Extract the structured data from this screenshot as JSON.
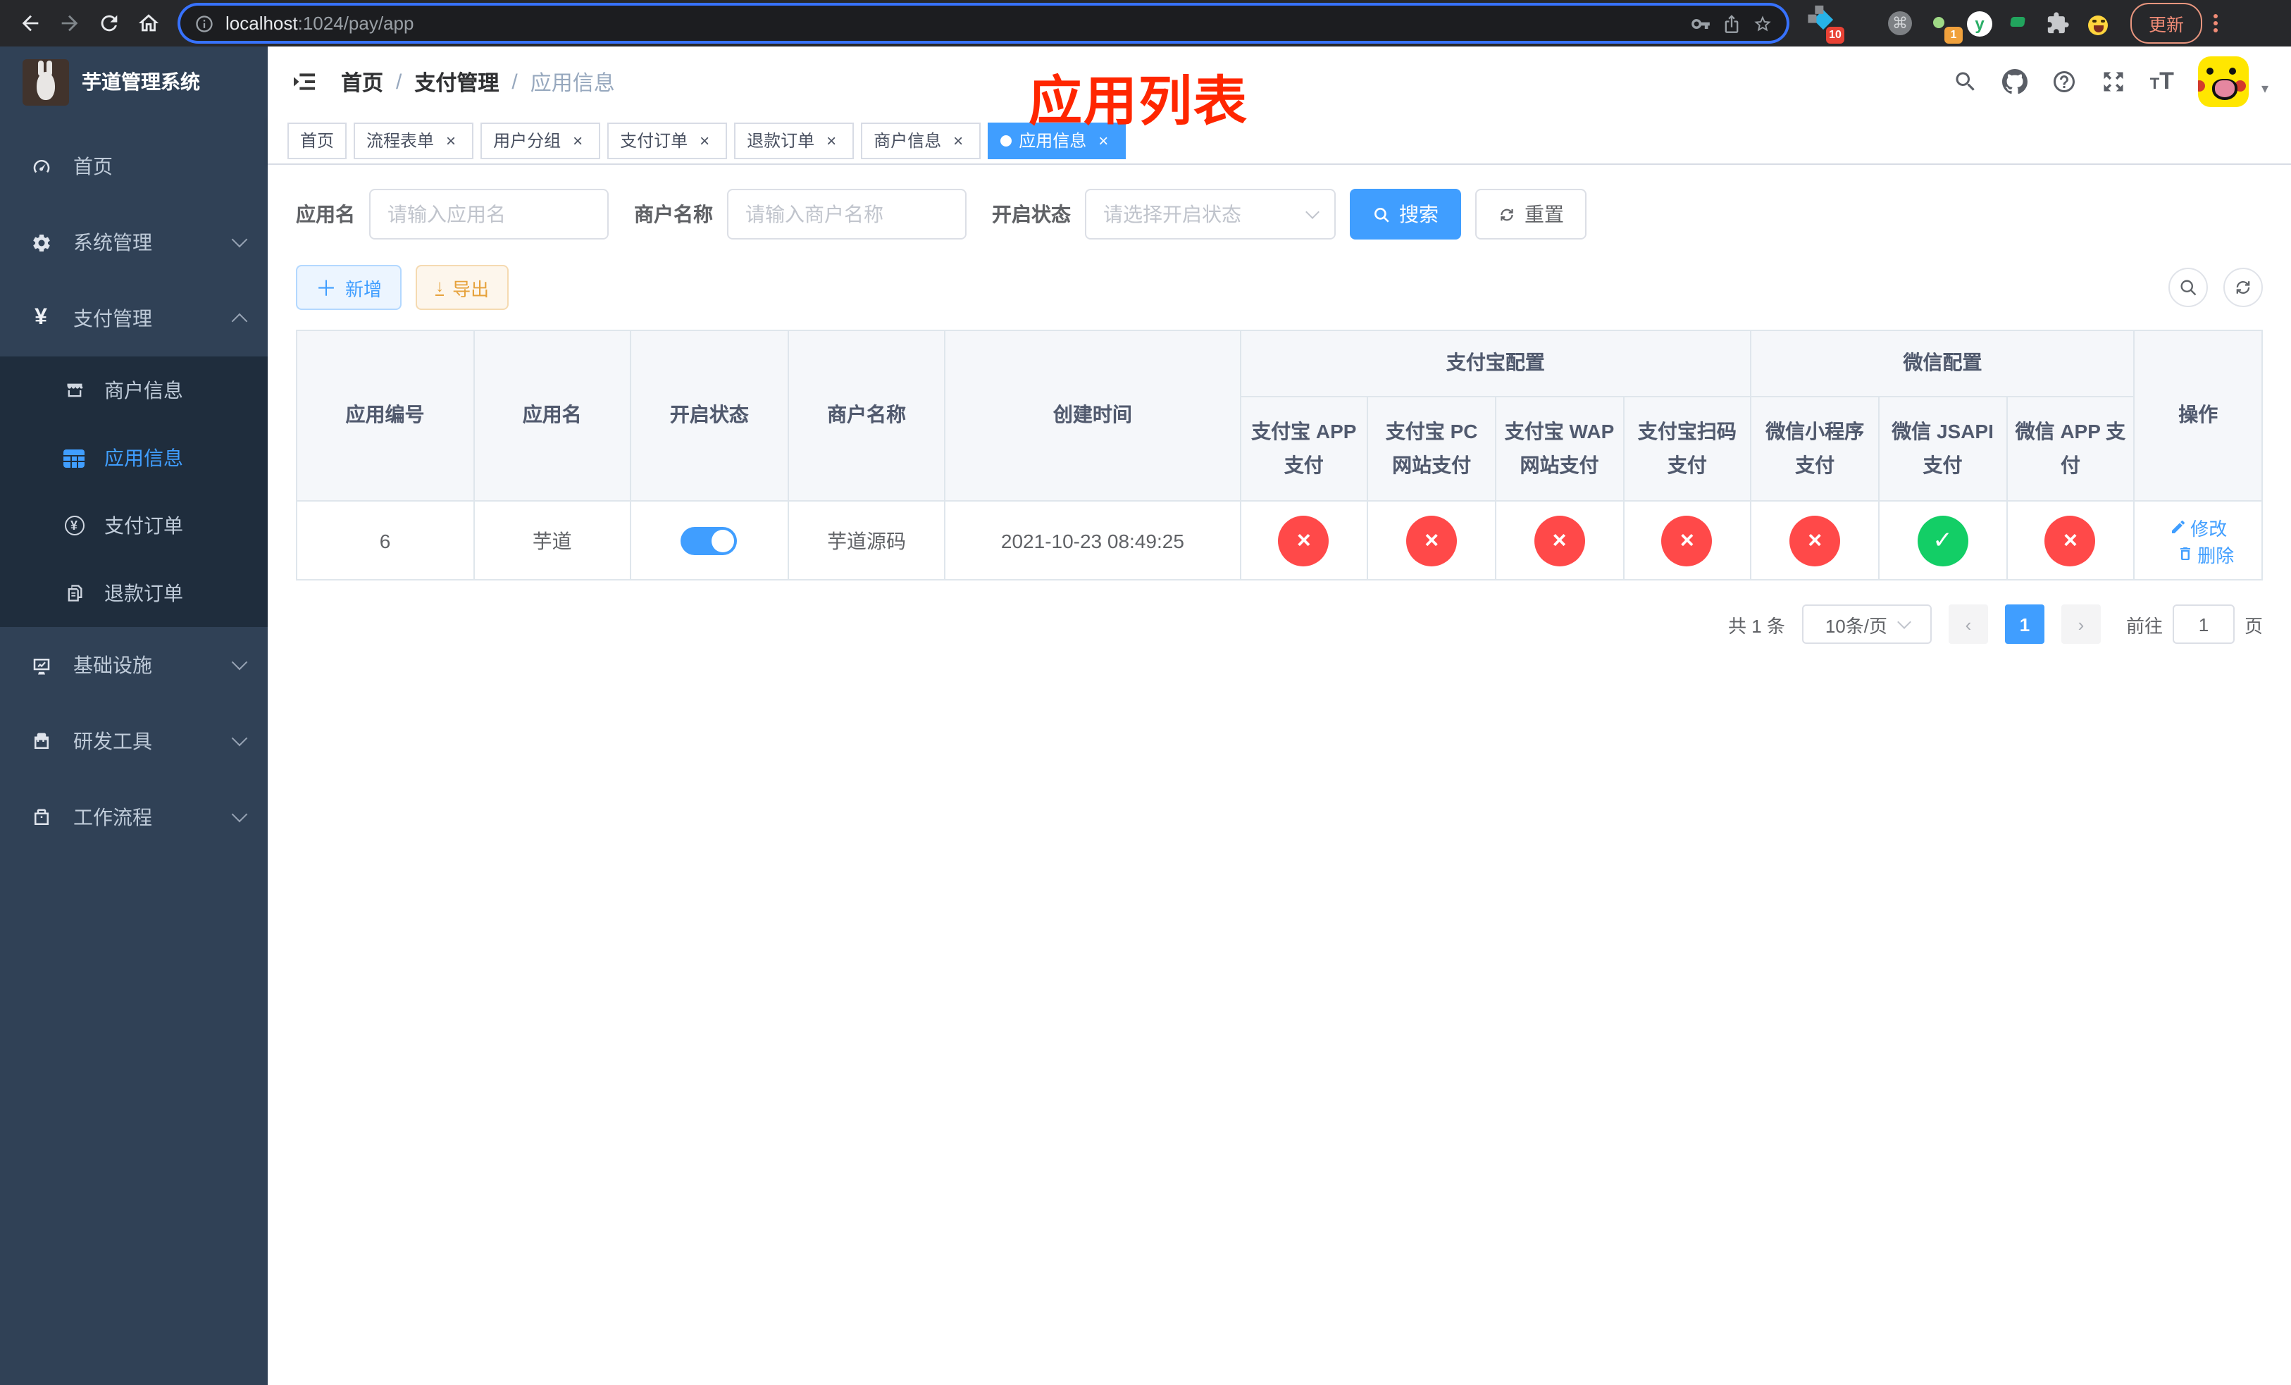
{
  "colors": {
    "accent": "#409eff",
    "danger": "#ff4949",
    "success": "#13ce66",
    "overlay_red": "#ff2600"
  },
  "browser": {
    "url_host": "localhost",
    "url_rest": ":1024/pay/app",
    "update_label": "更新",
    "ext_pin_badge": "10",
    "ext_dot_badge": "1",
    "ext_y_label": "y",
    "ext_cmd_glyph": "⌘"
  },
  "sidebar": {
    "title": "芋道管理系统",
    "items": [
      {
        "label": "首页"
      },
      {
        "label": "系统管理"
      },
      {
        "label": "支付管理"
      },
      {
        "label": "商户信息"
      },
      {
        "label": "应用信息",
        "active": true
      },
      {
        "label": "支付订单"
      },
      {
        "label": "退款订单"
      },
      {
        "label": "基础设施"
      },
      {
        "label": "研发工具"
      },
      {
        "label": "工作流程"
      }
    ]
  },
  "navbar": {
    "breadcrumb": [
      "首页",
      "支付管理",
      "应用信息"
    ]
  },
  "overlay_title": "应用列表",
  "tags": [
    {
      "label": "首页",
      "closable": false,
      "active": false
    },
    {
      "label": "流程表单",
      "closable": true,
      "active": false
    },
    {
      "label": "用户分组",
      "closable": true,
      "active": false
    },
    {
      "label": "支付订单",
      "closable": true,
      "active": false
    },
    {
      "label": "退款订单",
      "closable": true,
      "active": false
    },
    {
      "label": "商户信息",
      "closable": true,
      "active": false
    },
    {
      "label": "应用信息",
      "closable": true,
      "active": true
    }
  ],
  "filters": {
    "name_label": "应用名",
    "name_placeholder": "请输入应用名",
    "merchant_label": "商户名称",
    "merchant_placeholder": "请输入商户名称",
    "status_label": "开启状态",
    "status_placeholder": "请选择开启状态",
    "search_label": "搜索",
    "reset_label": "重置"
  },
  "toolbar": {
    "add_label": "新增",
    "export_label": "导出"
  },
  "table": {
    "col_id": "应用编号",
    "col_name": "应用名",
    "col_status": "开启状态",
    "col_merchant": "商户名称",
    "col_created": "创建时间",
    "col_ops": "操作",
    "group_alipay": "支付宝配置",
    "group_wechat": "微信配置",
    "pay_cols": [
      "支付宝 APP 支付",
      "支付宝 PC 网站支付",
      "支付宝 WAP 网站支付",
      "支付宝扫码支付",
      "微信小程序支付",
      "微信 JSAPI 支付",
      "微信 APP 支付"
    ],
    "row": {
      "id": "6",
      "name": "芋道",
      "enabled": true,
      "merchant": "芋道源码",
      "created": "2021-10-23 08:49:25",
      "pay_status": [
        "no",
        "no",
        "no",
        "no",
        "no",
        "yes",
        "no"
      ],
      "edit_label": "修改",
      "delete_label": "删除"
    }
  },
  "pagination": {
    "total": "共 1 条",
    "page_size": "10条/页",
    "page": "1",
    "goto_label": "前往",
    "goto_value": "1",
    "page_unit": "页"
  }
}
